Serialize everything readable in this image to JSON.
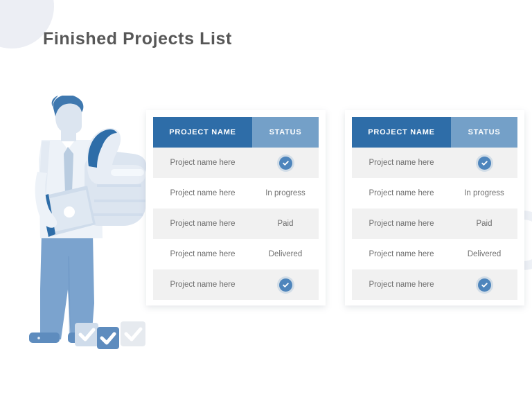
{
  "page": {
    "title": "Finished Projects List"
  },
  "theme": {
    "header_primary": "#2E6DA8",
    "header_secondary": "#74A0C8",
    "row_shade": "#F1F1F1",
    "row_plain": "#FFFFFF",
    "text_body": "#6F6F6F",
    "text_title": "#575757",
    "check_badge": "#4E85BC",
    "deco_circle": "#ECEEF4",
    "deco_ring": "#EEF1F6",
    "illustration_dark_blue": "#2E6DA8",
    "illustration_mid_blue": "#7BA3CE",
    "illustration_light": "#DCE5F0",
    "illustration_pale": "#EDF2F8"
  },
  "illustration": {
    "name": "businessman-holding-thumbs-up",
    "checkboxes": [
      {
        "name": "checkbox-tile-left",
        "fill": "#CFDCEB"
      },
      {
        "name": "checkbox-tile-center",
        "fill": "#5E8CBE"
      },
      {
        "name": "checkbox-tile-right",
        "fill": "#E6EAEF"
      }
    ]
  },
  "tables": [
    {
      "name": "projects-table-left",
      "columns": [
        "PROJECT NAME",
        "STATUS"
      ],
      "rows": [
        {
          "project": "Project name here",
          "status": "",
          "status_type": "check",
          "shaded": true
        },
        {
          "project": "Project name here",
          "status": "In progress",
          "status_type": "text",
          "shaded": false
        },
        {
          "project": "Project name here",
          "status": "Paid",
          "status_type": "text",
          "shaded": true
        },
        {
          "project": "Project name here",
          "status": "Delivered",
          "status_type": "text",
          "shaded": false
        },
        {
          "project": "Project name here",
          "status": "",
          "status_type": "check",
          "shaded": true
        }
      ]
    },
    {
      "name": "projects-table-right",
      "columns": [
        "PROJECT NAME",
        "STATUS"
      ],
      "rows": [
        {
          "project": "Project name here",
          "status": "",
          "status_type": "check",
          "shaded": true
        },
        {
          "project": "Project name here",
          "status": "In progress",
          "status_type": "text",
          "shaded": false
        },
        {
          "project": "Project name here",
          "status": "Paid",
          "status_type": "text",
          "shaded": true
        },
        {
          "project": "Project name here",
          "status": "Delivered",
          "status_type": "text",
          "shaded": false
        },
        {
          "project": "Project name here",
          "status": "",
          "status_type": "check",
          "shaded": true
        }
      ]
    }
  ]
}
